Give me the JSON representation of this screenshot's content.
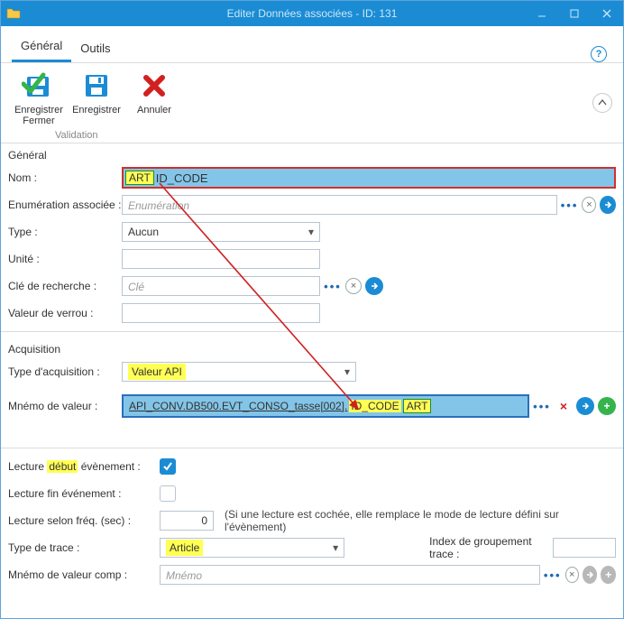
{
  "window": {
    "title": "Editer Données associées - ID: 131"
  },
  "tabs": {
    "general": "Général",
    "tools": "Outils"
  },
  "ribbon": {
    "save_close": "Enregistrer\nFermer",
    "save": "Enregistrer",
    "cancel": "Annuler",
    "group": "Validation"
  },
  "sections": {
    "general": "Général",
    "acquisition": "Acquisition"
  },
  "labels": {
    "nom": "Nom :",
    "enum": "Enumération associée :",
    "type": "Type :",
    "unite": "Unité :",
    "cle": "Clé de recherche :",
    "verrou": "Valeur de verrou :",
    "type_acq": "Type d'acquisition :",
    "mnemo_val": "Mnémo de valeur :",
    "lect_debut": "Lecture début évènement :",
    "lect_fin": "Lecture fin événement :",
    "lect_freq": "Lecture selon fréq. (sec) :",
    "type_trace": "Type de trace :",
    "index_group": "Index de groupement trace :",
    "mnemo_comp": "Mnémo de valeur comp :"
  },
  "values": {
    "nom_prefix": "ART",
    "nom_code": "ID_CODE",
    "enum_placeholder": "Enumération",
    "type": "Aucun",
    "cle_placeholder": "Clé",
    "type_acq": "Valeur API",
    "mnemo_base": "API_CONV.DB500.EVT_CONSO_tasse[002].",
    "mnemo_code": "ID_CODE",
    "mnemo_suffix": "ART",
    "lect_freq_val": "0",
    "lect_freq_note": "(Si une lecture est cochée, elle remplace le mode de lecture défini sur l'évènement)",
    "type_trace": "Article",
    "mnemo_comp_placeholder": "Mnémo",
    "debut_highlight": "début"
  },
  "flags": {
    "lect_debut_checked": true,
    "lect_fin_checked": false
  }
}
